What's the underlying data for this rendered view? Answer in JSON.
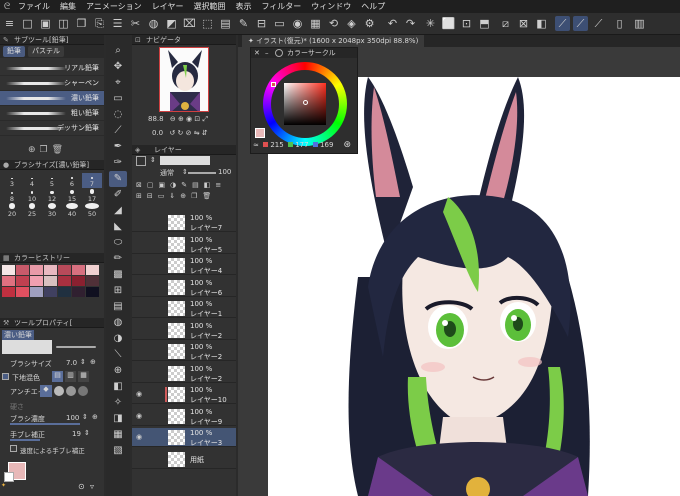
{
  "menu": {
    "items": [
      "ファイル",
      "編集",
      "アニメーション",
      "レイヤー",
      "選択範囲",
      "表示",
      "フィルター",
      "ウィンドウ",
      "ヘルプ"
    ]
  },
  "subtool_panel": {
    "title": "サブツール[鉛筆]",
    "tabs": [
      "鉛筆",
      "パステル"
    ],
    "brushes": [
      "リアル鉛筆",
      "シャーペン",
      "濃い鉛筆",
      "粗い鉛筆",
      "デッサン鉛筆"
    ],
    "selected_brush_index": 2
  },
  "brush_size_panel": {
    "title": "ブラシサイズ[濃い鉛筆]",
    "sizes": [
      "3",
      "4",
      "5",
      "6",
      "7",
      "8",
      "10",
      "12",
      "15",
      "17",
      "20",
      "25",
      "30",
      "40",
      "50"
    ],
    "selected_index": 4
  },
  "color_history": {
    "title": "カラーヒストリー",
    "colors": [
      "#f4e6e6",
      "#c85a6a",
      "#e89aa8",
      "#e8b8c0",
      "#b84a5a",
      "#d87080",
      "#f0d0d0",
      "#e07080",
      "#c04050",
      "#f0a0b0",
      "#d8c0c0",
      "#a83040",
      "#8a2030",
      "#503038",
      "#c03040",
      "#e05060",
      "#a0a0c0",
      "#404060",
      "#203040",
      "#302030",
      "#101020"
    ]
  },
  "tool_property": {
    "title": "ツールプロパティ[",
    "brush_name": "濃い鉛筆",
    "brush_size_label": "ブラシサイズ",
    "brush_size_value": "7.0",
    "base_color_label": "下地混色",
    "antialias_label": "アンチエイリ",
    "thickness_label": "硬さ",
    "brush_density_label": "ブラシ濃度",
    "brush_density_value": "100",
    "stabilization_label": "手ブレ補正",
    "stabilization_value": "19",
    "speed_stabilization_label": "速度による手ブレ補正",
    "main_color": "#e8b8b8"
  },
  "navigator": {
    "title": "ナビゲータ",
    "zoom": "88.8",
    "angle": "0.0"
  },
  "layer_panel": {
    "title": "レイヤー",
    "blend_mode": "通常",
    "opacity": "100",
    "layers": [
      {
        "pct": "100 %",
        "name": "レイヤー7",
        "red": false,
        "eye": false,
        "sel": false
      },
      {
        "pct": "100 %",
        "name": "レイヤー5",
        "red": false,
        "eye": false,
        "sel": false
      },
      {
        "pct": "100 %",
        "name": "レイヤー4",
        "red": false,
        "eye": false,
        "sel": false
      },
      {
        "pct": "100 %",
        "name": "レイヤー6",
        "red": false,
        "eye": false,
        "sel": false
      },
      {
        "pct": "100 %",
        "name": "レイヤー1",
        "red": false,
        "eye": false,
        "sel": false
      },
      {
        "pct": "100 %",
        "name": "レイヤー2",
        "red": false,
        "eye": false,
        "sel": false
      },
      {
        "pct": "100 %",
        "name": "レイヤー2",
        "red": false,
        "eye": false,
        "sel": false
      },
      {
        "pct": "100 %",
        "name": "レイヤー2",
        "red": false,
        "eye": false,
        "sel": false
      },
      {
        "pct": "100 %",
        "name": "レイヤー10",
        "red": true,
        "eye": true,
        "sel": false
      },
      {
        "pct": "100 %",
        "name": "レイヤー9",
        "red": false,
        "eye": true,
        "sel": false
      },
      {
        "pct": "100 %",
        "name": "レイヤー3",
        "red": false,
        "eye": true,
        "sel": true
      },
      {
        "pct": "",
        "name": "用紙",
        "red": false,
        "eye": false,
        "sel": false
      }
    ]
  },
  "document": {
    "tab_label": "イラスト(復元)* (1600 x 2048px 350dpi 88.8%)"
  },
  "color_circle": {
    "title": "カラーサークル",
    "h": "215",
    "s": "177",
    "v": "169",
    "h_color": "#e05050",
    "s_color": "#50c050",
    "v_color": "#5070e0"
  }
}
